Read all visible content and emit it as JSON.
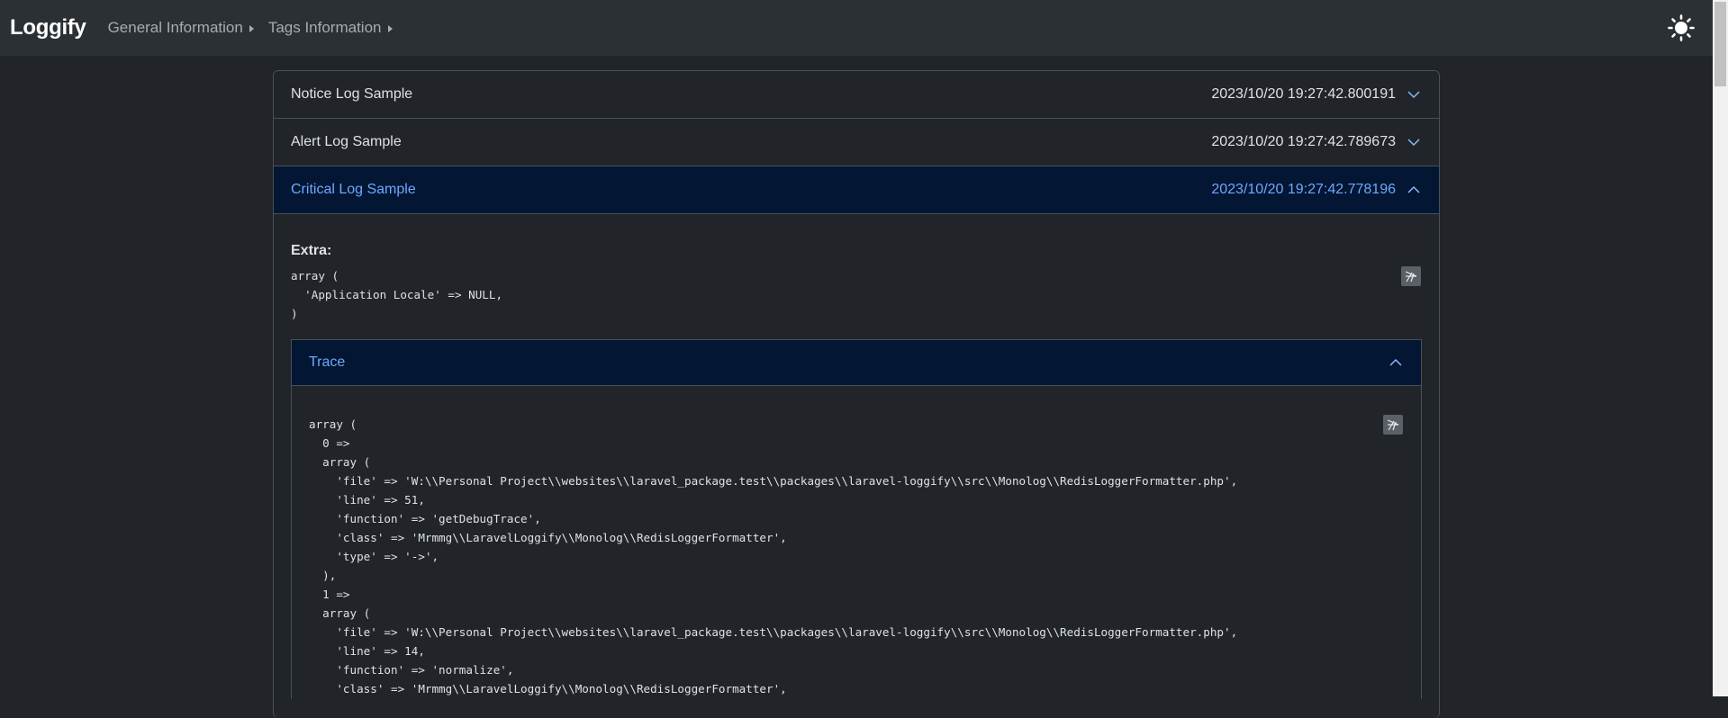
{
  "navbar": {
    "brand": "Loggify",
    "items": [
      {
        "label": "General Information"
      },
      {
        "label": "Tags Information"
      }
    ]
  },
  "logs": [
    {
      "title": "Notice Log Sample",
      "timestamp": "2023/10/20 19:27:42.800191",
      "expanded": false
    },
    {
      "title": "Alert Log Sample",
      "timestamp": "2023/10/20 19:27:42.789673",
      "expanded": false
    },
    {
      "title": "Critical Log Sample",
      "timestamp": "2023/10/20 19:27:42.778196",
      "expanded": true
    }
  ],
  "detail": {
    "extra_label": "Extra:",
    "extra_code": "array (\n  'Application Locale' => NULL,\n)",
    "trace_title": "Trace",
    "trace_code": "array (\n  0 =>\n  array (\n    'file' => 'W:\\\\Personal Project\\\\websites\\\\laravel_package.test\\\\packages\\\\laravel-loggify\\\\src\\\\Monolog\\\\RedisLoggerFormatter.php',\n    'line' => 51,\n    'function' => 'getDebugTrace',\n    'class' => 'Mrmmg\\\\LaravelLoggify\\\\Monolog\\\\RedisLoggerFormatter',\n    'type' => '->',\n  ),\n  1 =>\n  array (\n    'file' => 'W:\\\\Personal Project\\\\websites\\\\laravel_package.test\\\\packages\\\\laravel-loggify\\\\src\\\\Monolog\\\\RedisLoggerFormatter.php',\n    'line' => 14,\n    'function' => 'normalize',\n    'class' => 'Mrmmg\\\\LaravelLoggify\\\\Monolog\\\\RedisLoggerFormatter',"
  },
  "icons": {
    "theme": "sun-icon",
    "copy": "copy-icon",
    "expand": "chevron-down-icon",
    "collapse": "chevron-up-icon"
  },
  "colors": {
    "background": "#212529",
    "navbar": "#2b3035",
    "active_header": "#031633",
    "active_text": "#6ea8fe"
  }
}
